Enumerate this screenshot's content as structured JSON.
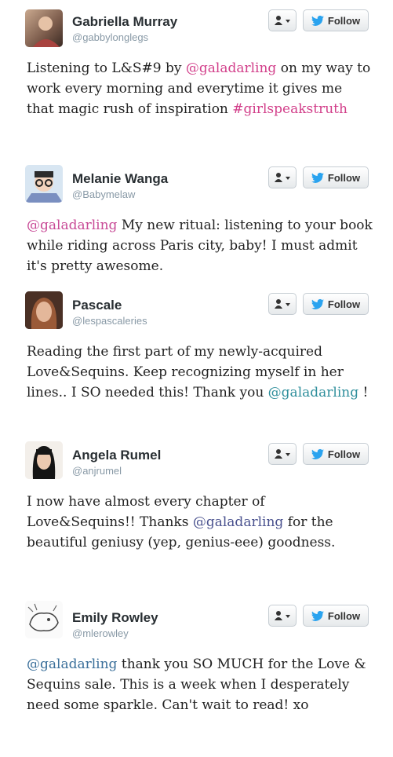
{
  "follow_label": "Follow",
  "tweets": [
    {
      "name": "Gabriella Murray",
      "handle": "@gabbylonglegs",
      "segments": [
        {
          "t": "Listening to L&S#9 by ",
          "m": ""
        },
        {
          "t": "@galadarling",
          "m": "m1"
        },
        {
          "t": " on my way to work every morning and everytime it gives me that magic rush of inspiration ",
          "m": ""
        },
        {
          "t": "#girlspeakstruth",
          "m": "m1"
        }
      ]
    },
    {
      "name": "Melanie Wanga",
      "handle": "@Babymelaw",
      "segments": [
        {
          "t": "@galadarling",
          "m": "m2"
        },
        {
          "t": " My new ritual: listening to your book while riding across Paris city, baby! I must admit it's pretty awesome.",
          "m": ""
        }
      ]
    },
    {
      "name": "Pascale",
      "handle": "@lespascaleries",
      "segments": [
        {
          "t": "Reading the first part of my newly-acquired Love&Sequins. Keep recognizing myself in her lines.. I SO needed this! Thank you ",
          "m": ""
        },
        {
          "t": "@galadarling",
          "m": "m3"
        },
        {
          "t": " !",
          "m": ""
        }
      ]
    },
    {
      "name": "Angela Rumel",
      "handle": "@anjrumel",
      "segments": [
        {
          "t": "I now have almost every chapter of Love&Sequins!! Thanks ",
          "m": ""
        },
        {
          "t": "@galadarling",
          "m": "m4"
        },
        {
          "t": " for the beautiful geniusy (yep, genius-eee) goodness.",
          "m": ""
        }
      ]
    },
    {
      "name": "Emily Rowley",
      "handle": "@mlerowley",
      "segments": [
        {
          "t": "@galadarling",
          "m": "m5"
        },
        {
          "t": " thank you SO MUCH for the Love & Sequins sale. This is a week when I desperately need some sparkle. Can't wait to read! xo",
          "m": ""
        }
      ]
    }
  ]
}
